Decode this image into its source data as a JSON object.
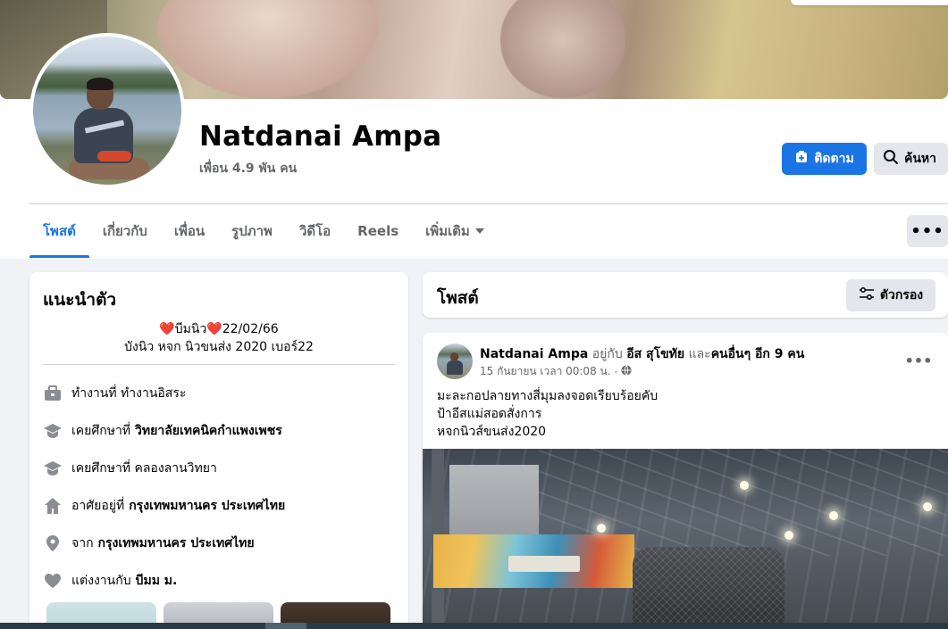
{
  "profile": {
    "name": "Natdanai Ampa",
    "friends": "เพื่อน 4.9 พัน คน"
  },
  "actions": {
    "follow_label": "ติดตาม",
    "search_label": "ค้นหา"
  },
  "tabs": [
    {
      "label": "โพสต์",
      "active": true
    },
    {
      "label": "เกี่ยวกับ"
    },
    {
      "label": "เพื่อน"
    },
    {
      "label": "รูปภาพ"
    },
    {
      "label": "วิดีโอ"
    },
    {
      "label": "Reels"
    },
    {
      "label": "เพิ่มเติม"
    }
  ],
  "more_menu_icon": "ellipsis-icon",
  "intro": {
    "title": "แนะนำตัว",
    "bio_line1_name": "บีมนิว",
    "bio_line1_date": "22/02/66",
    "bio_line2": "บังนิว หจก นิวขนส่ง 2020 เบอร์22",
    "rows": [
      {
        "icon": "briefcase-icon",
        "text": "ทำงานที่ ทำงานอิสระ",
        "bold": ""
      },
      {
        "icon": "graduation-cap-icon",
        "text": "เคยศึกษาที่",
        "bold": "วิทยาลัยเทคนิคกำแพงเพชร"
      },
      {
        "icon": "graduation-cap-icon",
        "text": "เคยศึกษาที่ คลองลานวิทยา",
        "bold": ""
      },
      {
        "icon": "home-icon",
        "text": "อาศัยอยู่ที่",
        "bold": "กรุงเทพมหานคร ประเทศไทย"
      },
      {
        "icon": "location-pin-icon",
        "text": "จาก",
        "bold": "กรุงเทพมหานคร ประเทศไทย"
      },
      {
        "icon": "heart-icon",
        "text": "แต่งงานกับ",
        "bold": "บีมม ม."
      }
    ]
  },
  "posts_header": {
    "title": "โพสต์",
    "filter_label": "ตัวกรอง"
  },
  "post": {
    "author": "Natdanai Ampa",
    "with_text": "อยู่กับ",
    "with_name": "อีส สุโขทัย",
    "and_text": "และ",
    "others": "คนอื่นๆ อีก 9 คน",
    "timestamp": "15 กันยายน เวลา 00:08 น.",
    "privacy_icon": "globe-icon",
    "lines": [
      "มะละกอปลายทางสี่มุมลงจอดเรียบร้อยคับ",
      "ป้าอีสแม่สอดสั่งการ",
      "หจกนิวส์ขนส่ง2020"
    ]
  },
  "colors": {
    "accent": "#1b74e4",
    "muted_text": "#65676b",
    "button_gray": "#e4e6eb",
    "page_bg": "#f0f2f5"
  }
}
